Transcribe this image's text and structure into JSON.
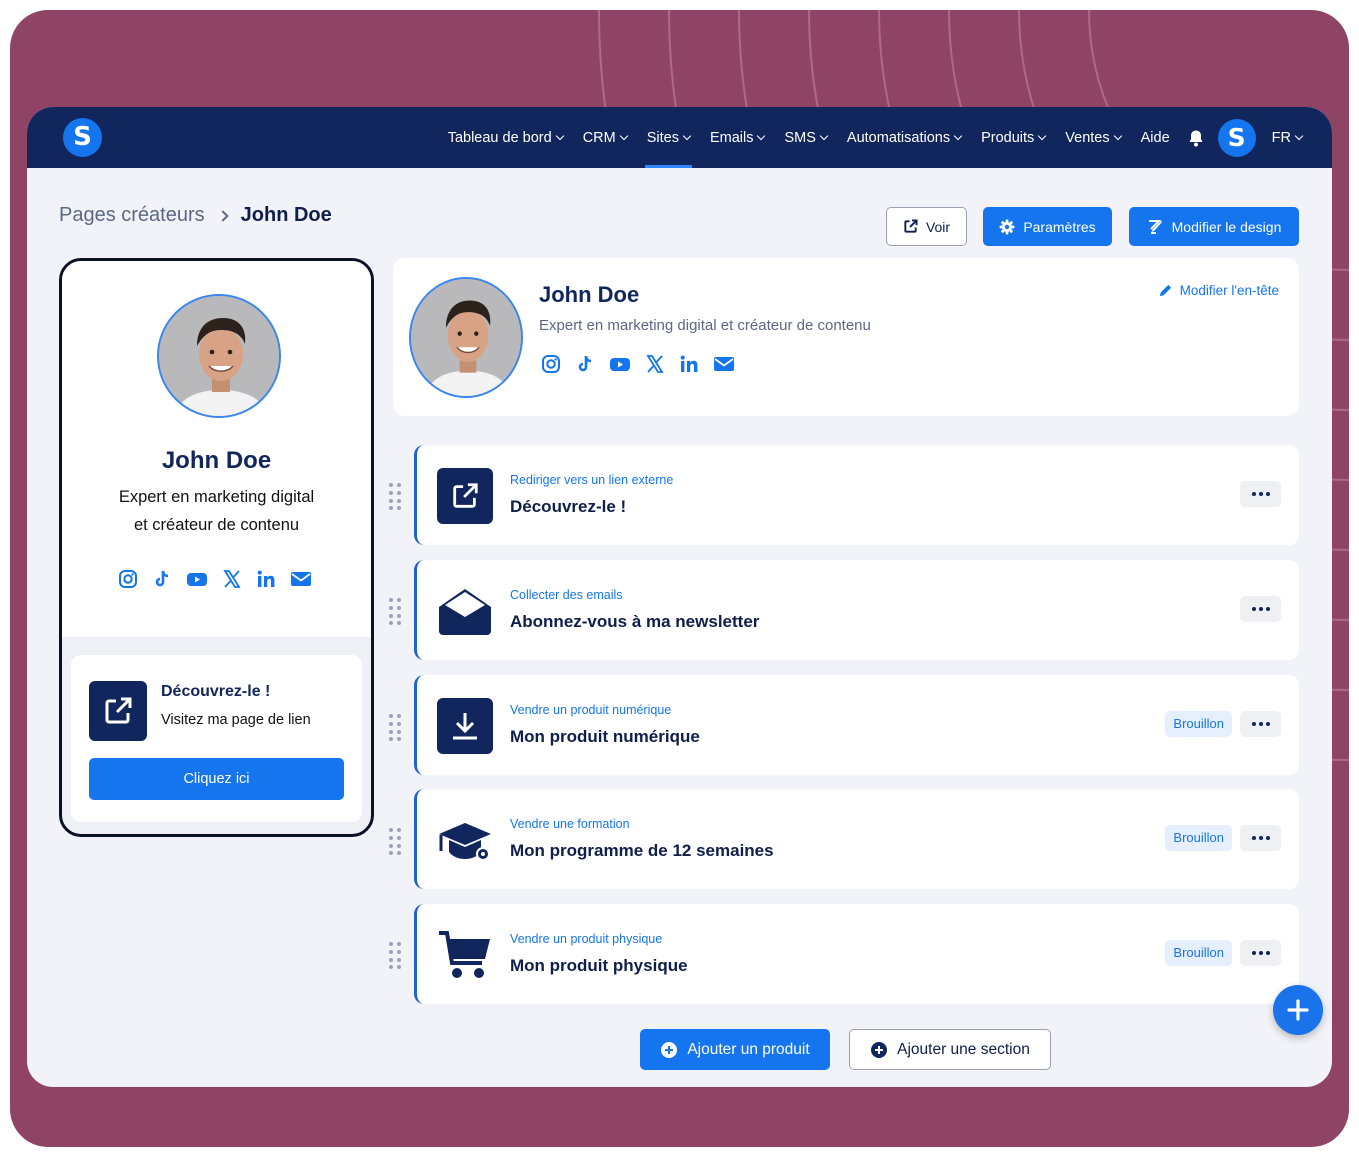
{
  "nav": {
    "logo": "S",
    "items": [
      {
        "label": "Tableau de bord"
      },
      {
        "label": "CRM"
      },
      {
        "label": "Sites"
      },
      {
        "label": "Emails"
      },
      {
        "label": "SMS"
      },
      {
        "label": "Automatisations"
      },
      {
        "label": "Produits"
      },
      {
        "label": "Ventes"
      }
    ],
    "help": "Aide",
    "avatar": "S",
    "lang": "FR",
    "active_item": "Sites"
  },
  "breadcrumb": {
    "parent": "Pages créateurs",
    "current": "John Doe"
  },
  "toolbar": {
    "view": "Voir",
    "settings": "Paramètres",
    "design": "Modifier le design"
  },
  "preview": {
    "name": "John Doe",
    "bio_line1": "Expert en marketing digital",
    "bio_line2": "et créateur de contenu",
    "socials": [
      "instagram-icon",
      "tiktok-icon",
      "youtube-icon",
      "x-icon",
      "linkedin-icon",
      "mail-icon"
    ],
    "card": {
      "title": "Découvrez-le !",
      "subtitle": "Visitez ma page de lien",
      "button": "Cliquez ici"
    }
  },
  "header": {
    "name": "John Doe",
    "bio": "Expert en marketing digital et créateur de contenu",
    "edit": "Modifier l'en-tête"
  },
  "items": [
    {
      "kind": "Rediriger vers un lien externe",
      "title": "Découvrez-le !",
      "icon": "external-link-icon",
      "badge": ""
    },
    {
      "kind": "Collecter des emails",
      "title": "Abonnez-vous à ma newsletter",
      "icon": "envelope-open-icon",
      "badge": ""
    },
    {
      "kind": "Vendre un produit numérique",
      "title": "Mon produit numérique",
      "icon": "download-icon",
      "badge": "Brouillon"
    },
    {
      "kind": "Vendre une formation",
      "title": "Mon programme de 12 semaines",
      "icon": "graduation-cap-icon",
      "badge": "Brouillon"
    },
    {
      "kind": "Vendre un produit physique",
      "title": "Mon produit physique",
      "icon": "cart-icon",
      "badge": "Brouillon"
    }
  ],
  "actions": {
    "add_product": "Ajouter un produit",
    "add_section": "Ajouter une section"
  },
  "colors": {
    "navy": "#10265c",
    "accent": "#1575ee",
    "frame": "#8f4466",
    "bg": "#f2f3f8"
  }
}
